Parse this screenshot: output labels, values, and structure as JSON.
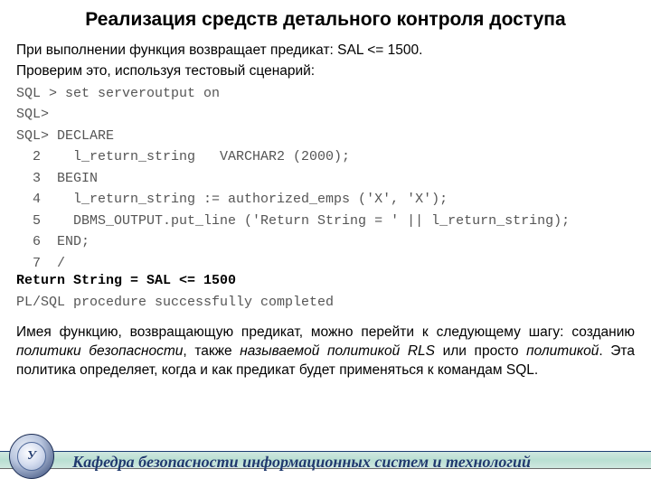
{
  "title": "Реализация средств детального контроля доступа",
  "intro1": "При выполнении функция возвращает предикат: SAL <= 1500.",
  "intro2": "Проверим это, используя тестовый сценарий:",
  "code_lines": [
    "SQL > set serveroutput on",
    "SQL>",
    "SQL> DECLARE",
    "  2    l_return_string   VARCHAR2 (2000);",
    "  3  BEGIN",
    "  4    l_return_string := authorized_emps ('X', 'X');",
    "  5    DBMS_OUTPUT.put_line ('Return String = ' || l_return_string);",
    "  6  END;",
    "  7  /"
  ],
  "result_bold": "Return String = SAL <= 1500",
  "result_tail": "PL/SQL procedure successfully completed",
  "para_parts": {
    "p1": "Имея функцию, возвращающую предикат, можно перейти к следующему шагу: созданию ",
    "i1": "политики безопасности",
    "p2": ", также ",
    "i2": "называемой политикой RLS",
    "p3": " или просто ",
    "i3": "политикой",
    "p4": ". Эта политика определяет, когда и как предикат будет применяться к командам SQL."
  },
  "footer": "Кафедра безопасности информационных систем и технологий",
  "crest_letter": "У"
}
